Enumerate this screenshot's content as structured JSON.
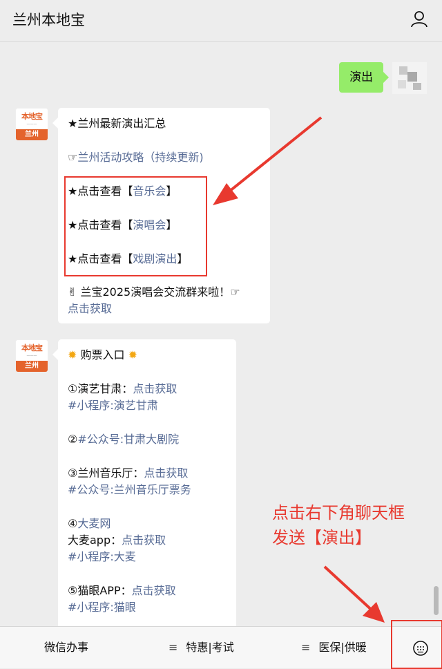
{
  "header": {
    "title": "兰州本地宝"
  },
  "conversation": {
    "sent_message": "演出",
    "avatar_logo": "本地宝",
    "avatar_city": "兰州",
    "message1": {
      "line1": "★兰州最新演出汇总",
      "line2_prefix": "☞",
      "line2_link": "兰州活动攻略（持续更新)",
      "line3_prefix": "★点击查看【",
      "line3_link": "音乐会",
      "line3_suffix": "】",
      "line4_prefix": "★点击查看【",
      "line4_link": "演唱会",
      "line4_suffix": "】",
      "line5_prefix": "★点击查看【",
      "line5_link": "戏剧演出",
      "line5_suffix": "】",
      "line6": "✌ 兰宝2025演唱会交流群来啦！☞",
      "line7_link": "点击获取"
    },
    "message2": {
      "line1": "购票入口",
      "i1_text": "①演艺甘肃：",
      "i1_link": "点击获取",
      "i1_tag": "#小程序:演艺甘肃",
      "i2_prefix": "②",
      "i2_tag": "#公众号:甘肃大剧院",
      "i3_text": "③兰州音乐厅：",
      "i3_link": "点击获取",
      "i3_tag": "#公众号:兰州音乐厅票务",
      "i4_prefix": "④",
      "i4_link": "大麦网",
      "i4b_text": "大麦app：",
      "i4b_link": "点击获取",
      "i4_tag": "#小程序:大麦",
      "i5_text": "⑤猫眼APP：",
      "i5_link": "点击获取",
      "i5_tag": "#小程序:猫眼"
    }
  },
  "annotation": {
    "line1": "点击右下角聊天框",
    "line2": "发送【演出】"
  },
  "bottom_menu": {
    "item1": "微信办事",
    "item2": "特惠|考试",
    "item3": "医保|供暖"
  },
  "colors": {
    "link": "#576b95",
    "accent_red": "#e8392f",
    "bubble_green": "#95ec69"
  }
}
